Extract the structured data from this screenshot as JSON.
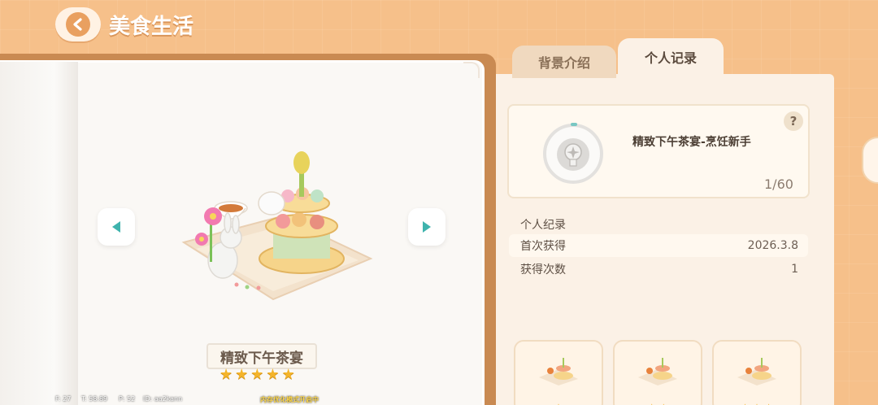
{
  "header": {
    "title": "美食生活"
  },
  "tabs": [
    {
      "label": "背景介绍",
      "active": false
    },
    {
      "label": "个人记录",
      "active": true
    }
  ],
  "dish": {
    "name": "精致下午茶宴",
    "stars": 5
  },
  "achievement": {
    "title": "精致下午茶宴-烹饪新手",
    "progress": "1/60",
    "help": "?"
  },
  "personal_record": {
    "section_title": "个人纪录",
    "rows": [
      {
        "label": "首次获得",
        "value": "2026.3.8"
      },
      {
        "label": "获得次数",
        "value": "1"
      }
    ]
  },
  "debug": {
    "f": "F: 27",
    "t": "T: 58.89",
    "p": "P: 52",
    "id": "ID: aa2kann",
    "notice": "内存优化模式开启中"
  },
  "icons": {
    "back": "chevron-left-icon",
    "prev": "triangle-left-icon",
    "next": "triangle-right-icon",
    "badge": "medal-badge-icon",
    "star": "star-icon"
  },
  "colors": {
    "background": "#f6c08a",
    "accent_teal": "#3fb3ad",
    "star": "#f4b42a",
    "panel": "#fbf1e6"
  }
}
